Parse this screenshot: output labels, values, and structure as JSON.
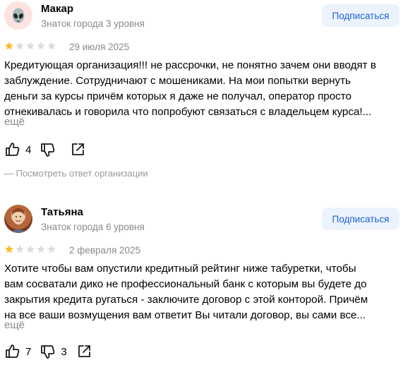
{
  "reviews": [
    {
      "author": "Макар",
      "level": "Знаток города 3 уровня",
      "subscribe_label": "Подписаться",
      "rating": 1,
      "rating_max": 5,
      "date": "29 июля 2025",
      "text_lines": [
        "Кредитующая организация!!! не рассрочки, не понятно зачем они вводят в",
        "заблуждение. Сотрудничают с мошениками. На мои попытки вернуть",
        "деньги за курсы причём которых я даже не получал, оператор просто",
        "отнекивалась и говорила что попробуют связаться с владельцем курса!..."
      ],
      "more_label": "ещё",
      "likes": "4",
      "dislikes": "",
      "org_answer_label": "— Посмотреть ответ организации",
      "avatar_icon": "alien-icon"
    },
    {
      "author": "Татьяна",
      "level": "Знаток города 6 уровня",
      "subscribe_label": "Подписаться",
      "rating": 1,
      "rating_max": 5,
      "date": "2 февраля 2025",
      "text_lines": [
        "Хотите чтобы вам опустили кредитный рейтинг ниже табуретки, чтобы",
        "вам сосватали дико не профессиональный банк с которым вы будете до",
        "закрытия кредита ругаться - заключите договор с этой конторой. Причём",
        "на все ваши возмущения вам ответит Вы читали договор, вы сами все..."
      ],
      "more_label": "ещё",
      "likes": "7",
      "dislikes": "3",
      "avatar_icon": "user-photo"
    }
  ],
  "colors": {
    "star_filled": "#fcbc1c",
    "star_empty": "#dcdcdc",
    "subscribe_bg": "#edf3fd",
    "subscribe_text": "#1a62d8",
    "muted_text": "#8a8a8a"
  }
}
